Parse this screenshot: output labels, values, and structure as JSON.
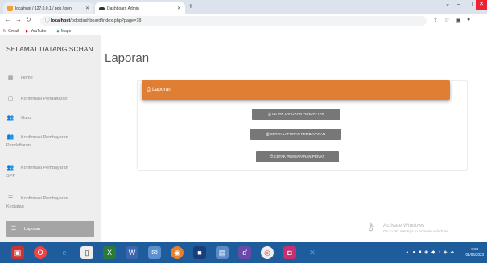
{
  "browser": {
    "tabs": [
      {
        "label": "localhost / 127.0.0.1 / pob / pen"
      },
      {
        "label": "Dashboard Admin"
      }
    ],
    "url_host": "localhost",
    "url_path": "/pob/dashboard/index.php?page=18",
    "bookmarks": [
      "Gmail",
      "YouTube",
      "Maps"
    ]
  },
  "sidebar": {
    "brand": "SELAMAT DATANG SCHAN",
    "items": [
      {
        "label": "Home",
        "icon": "dashboard-icon"
      },
      {
        "label": "Konfirmasi Pendaftaran",
        "icon": "square-icon"
      },
      {
        "label": "Guru",
        "icon": "users-icon"
      },
      {
        "label": "Konfirmasi Pembayaran",
        "label2": "Pendaftaran",
        "icon": "users-icon"
      },
      {
        "label": "Konfirmasi Pembayaran",
        "label2": "SPP",
        "icon": "users-icon"
      },
      {
        "label": "Konfirmasi Pembayaran",
        "label2": "Kegiatan",
        "icon": "list-icon"
      },
      {
        "label": "Laporan",
        "icon": "list-icon",
        "active": true
      }
    ]
  },
  "main": {
    "title": "Laporan",
    "card_header": "Laporan",
    "buttons": [
      "CETAK LAPORAN PENDAFTAR",
      "CETAK LAPORAN PEMBAYARAN",
      "CETAK PEMBAYARAN PRIVAT"
    ]
  },
  "watermark": {
    "title": "Activate Windows",
    "subtitle": "Go to PC settings to activate Windows."
  },
  "taskbar": {
    "time": "8:04",
    "date": "01/06/2023"
  },
  "colors": {
    "accent": "#e07e33",
    "button": "#777777",
    "sidebar_bg": "#eeeeee",
    "taskbar": "#1e5c9b"
  }
}
